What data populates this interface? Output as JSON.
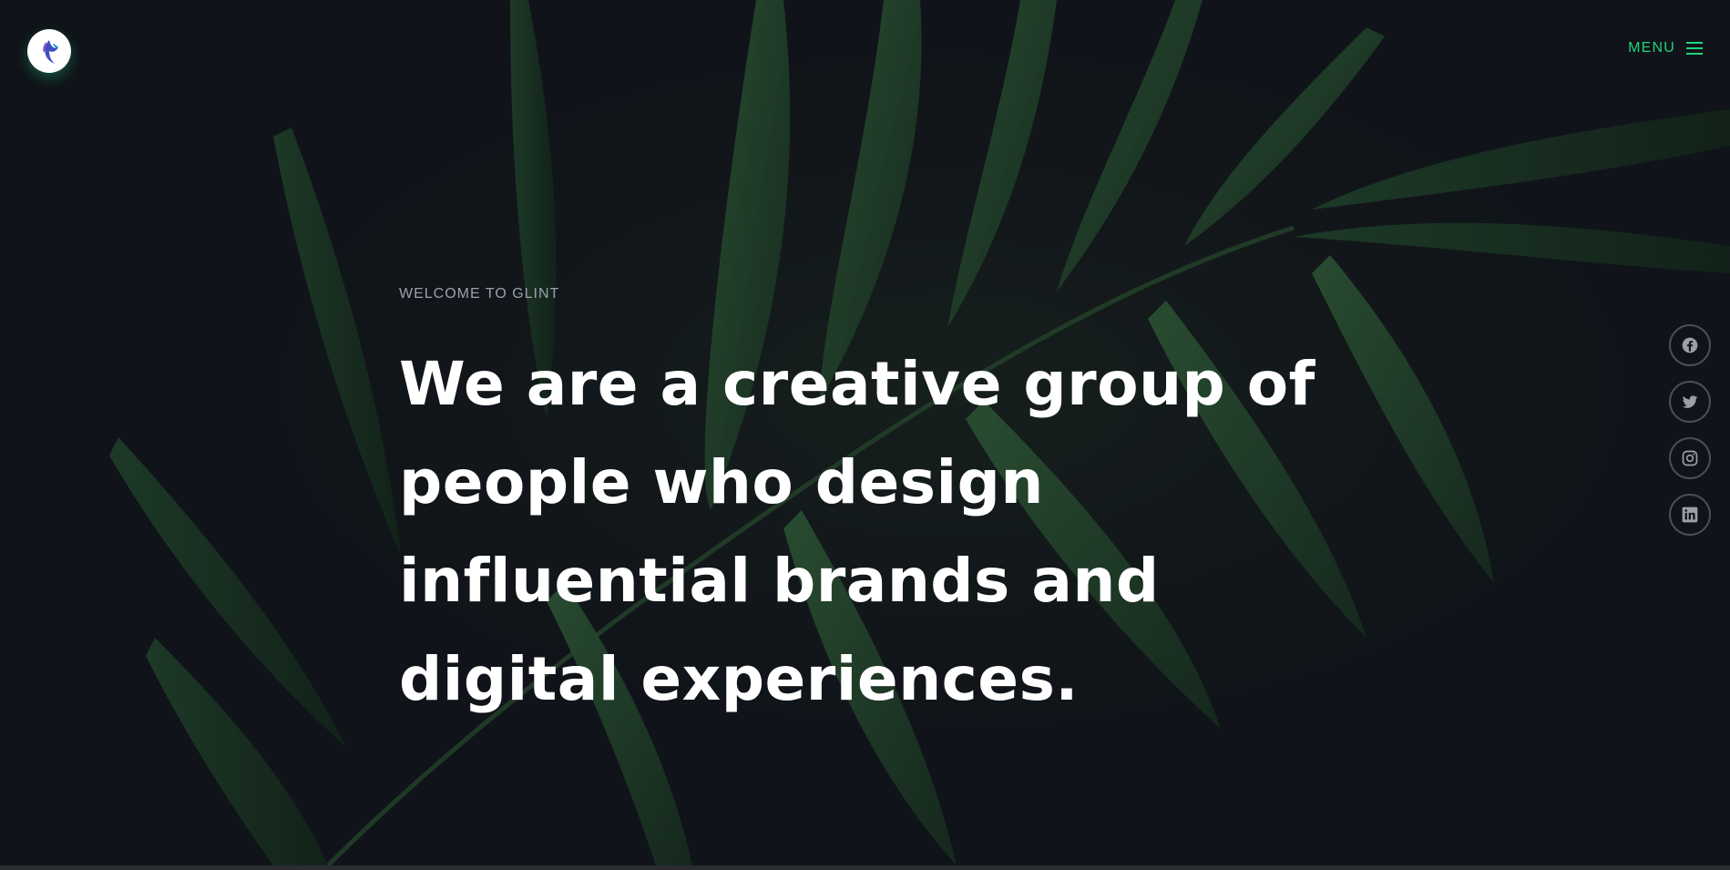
{
  "header": {
    "logo_icon": "bird-logo-icon",
    "menu_label": "MENU",
    "menu_icon": "hamburger-icon",
    "accent_color": "#1fd67a"
  },
  "hero": {
    "pre_title": "WELCOME TO GLINT",
    "headline": "We are a creative group of people who design influential brands and digital experiences.",
    "background": "dark palm leaves with water droplets"
  },
  "social": [
    {
      "name": "facebook",
      "icon": "facebook-icon"
    },
    {
      "name": "twitter",
      "icon": "twitter-icon"
    },
    {
      "name": "instagram",
      "icon": "instagram-icon"
    },
    {
      "name": "linkedin",
      "icon": "linkedin-icon"
    }
  ]
}
